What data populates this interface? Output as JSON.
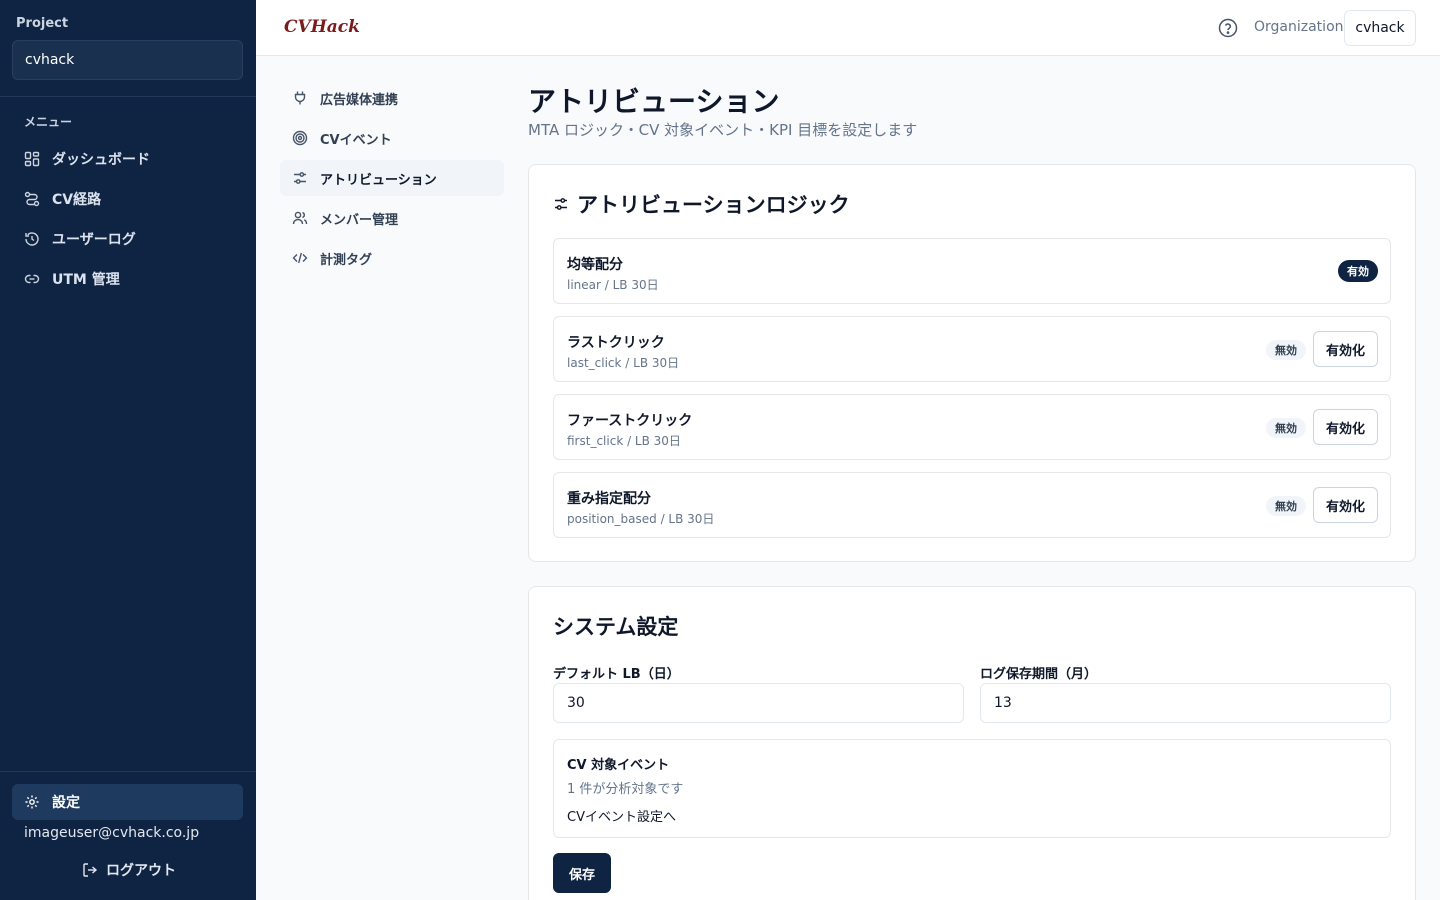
{
  "sidebar": {
    "project_label": "Project",
    "project_name": "cvhack",
    "menu_label": "メニュー",
    "items": [
      {
        "label": "ダッシュボード",
        "icon": "dashboard-icon"
      },
      {
        "label": "CV経路",
        "icon": "route-icon"
      },
      {
        "label": "ユーザーログ",
        "icon": "history-icon"
      },
      {
        "label": "UTM 管理",
        "icon": "link-icon"
      }
    ],
    "settings_label": "設定",
    "user_email": "imageuser@cvhack.co.jp",
    "logout_label": "ログアウト"
  },
  "header": {
    "logo": "CVHack",
    "org_label": "Organization",
    "org_name": "cvhack"
  },
  "subnav": {
    "items": [
      {
        "label": "広告媒体連携",
        "icon": "plug-icon"
      },
      {
        "label": "CVイベント",
        "icon": "target-icon"
      },
      {
        "label": "アトリビューション",
        "icon": "sliders-icon",
        "active": true
      },
      {
        "label": "メンバー管理",
        "icon": "users-icon"
      },
      {
        "label": "計測タグ",
        "icon": "code-icon"
      }
    ]
  },
  "main": {
    "title": "アトリビューション",
    "subtitle": "MTA ロジック・CV 対象イベント・KPI 目標を設定します",
    "logic_card": {
      "title": "アトリビューションロジック",
      "rows": [
        {
          "name": "均等配分",
          "meta": "linear / LB 30日",
          "status": "有効",
          "enabled": true
        },
        {
          "name": "ラストクリック",
          "meta": "last_click / LB 30日",
          "status": "無効",
          "button": "有効化"
        },
        {
          "name": "ファーストクリック",
          "meta": "first_click / LB 30日",
          "status": "無効",
          "button": "有効化"
        },
        {
          "name": "重み指定配分",
          "meta": "position_based / LB 30日",
          "status": "無効",
          "button": "有効化"
        }
      ]
    },
    "system_card": {
      "title": "システム設定",
      "default_lb_label": "デフォルト LB（日）",
      "default_lb_value": "30",
      "log_retention_label": "ログ保存期間（月）",
      "log_retention_value": "13",
      "cv_title": "CV 対象イベント",
      "cv_count": "1 件が分析対象です",
      "cv_link": "CVイベント設定へ",
      "save_label": "保存"
    }
  },
  "colors": {
    "sidebar_bg": "#0f2342",
    "accent": "#0f2342",
    "logo": "#7a1c1c"
  }
}
